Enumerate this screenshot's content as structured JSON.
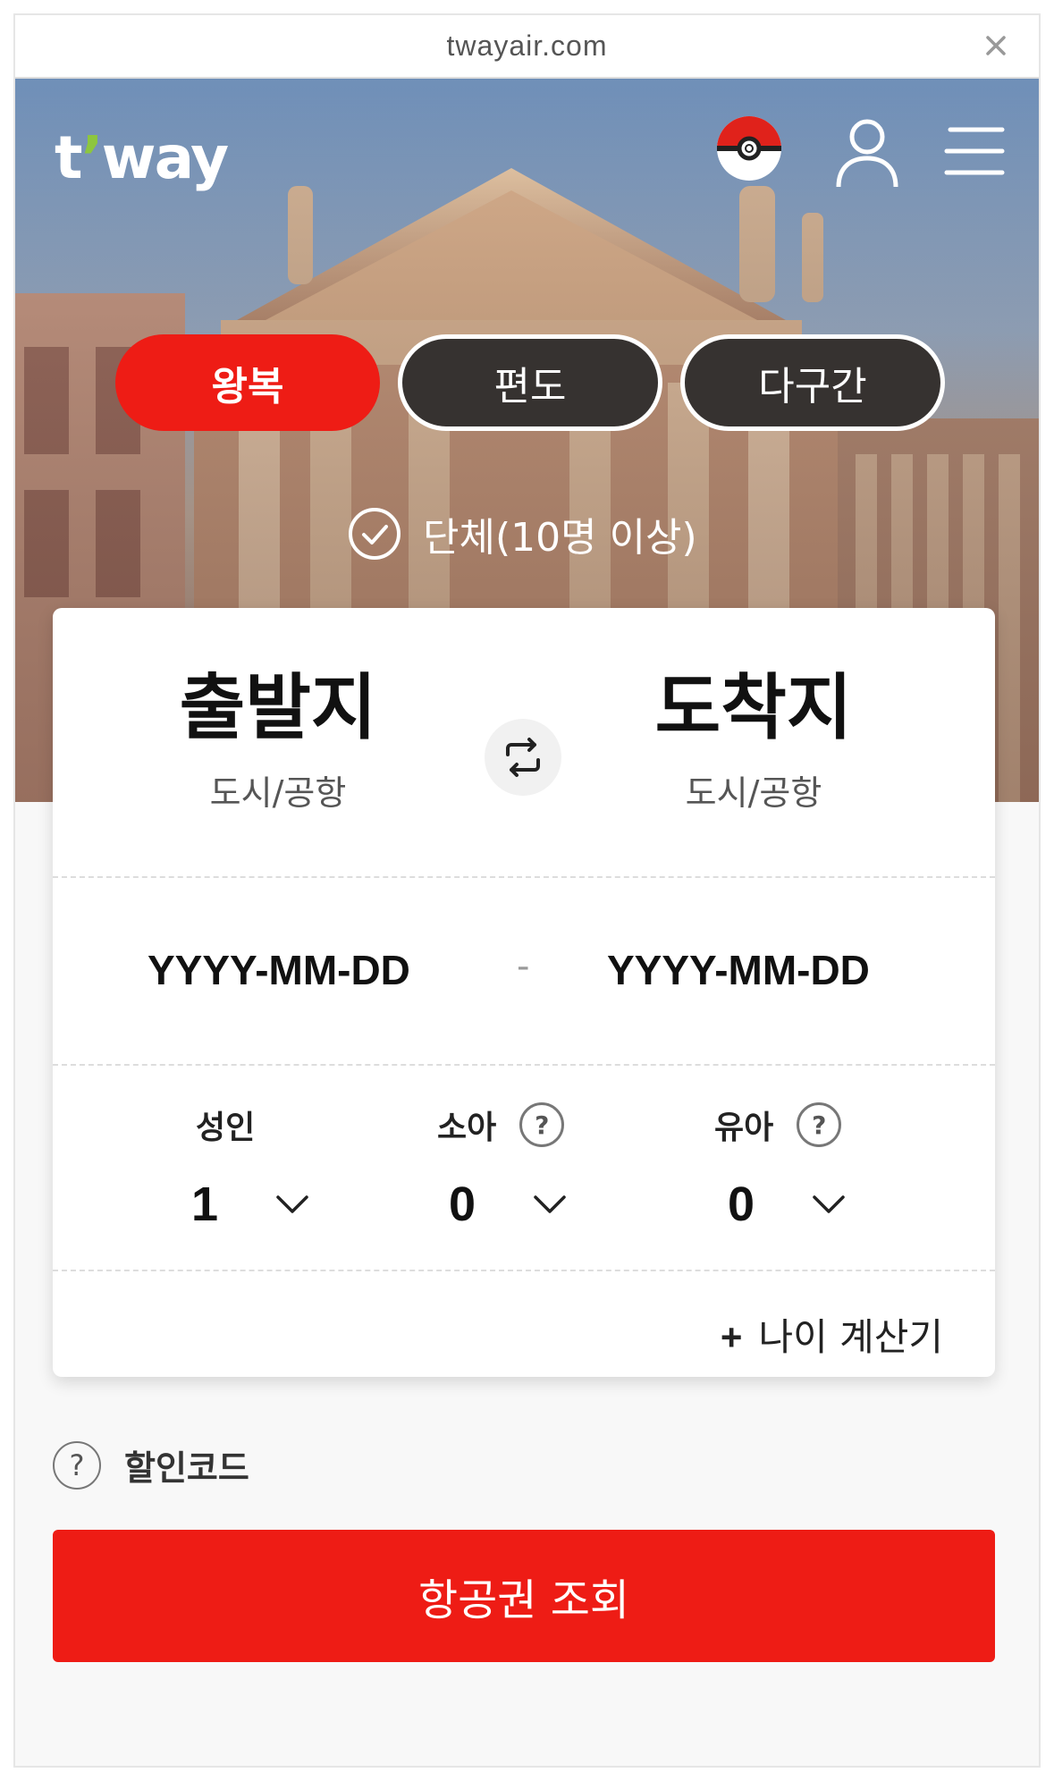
{
  "browser": {
    "url": "twayair.com"
  },
  "header": {
    "logo_main": "t",
    "logo_tail": "way"
  },
  "trip_tabs": [
    {
      "label": "왕복",
      "active": true
    },
    {
      "label": "편도",
      "active": false
    },
    {
      "label": "다구간",
      "active": false
    }
  ],
  "group_option": {
    "label": "단체(10명 이상)"
  },
  "route": {
    "origin": {
      "title": "출발지",
      "subtitle": "도시/공항"
    },
    "destination": {
      "title": "도착지",
      "subtitle": "도시/공항"
    }
  },
  "dates": {
    "start": "YYYY-MM-DD",
    "separator": "-",
    "end": "YYYY-MM-DD"
  },
  "passengers": [
    {
      "label": "성인",
      "value": "1",
      "has_help": false
    },
    {
      "label": "소아",
      "value": "0",
      "has_help": true
    },
    {
      "label": "유아",
      "value": "0",
      "has_help": true
    }
  ],
  "age_calculator": {
    "plus": "+",
    "label": "나이 계산기"
  },
  "discount": {
    "label": "할인코드",
    "help_glyph": "?"
  },
  "search_button": {
    "label": "항공권 조회"
  },
  "colors": {
    "accent": "#ee1c15",
    "tab_inactive": "#363230",
    "logo_apostrophe": "#8dc63f"
  }
}
